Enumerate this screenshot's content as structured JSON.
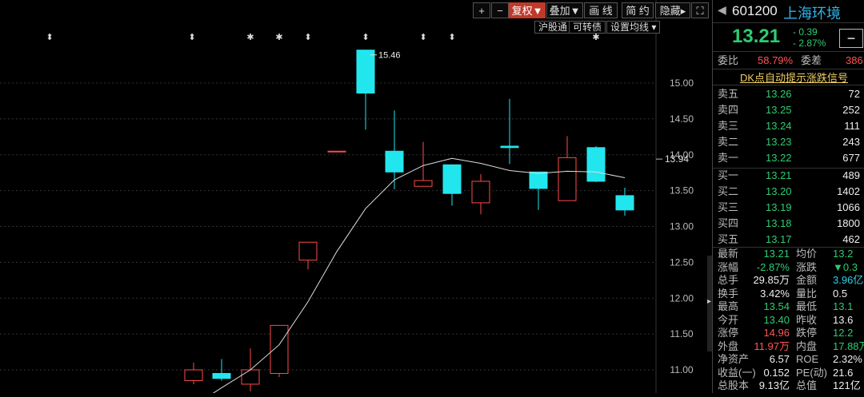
{
  "toolbar": {
    "plus": "+",
    "minus": "−",
    "fuquan": "复权▼",
    "diejia": "叠加▼",
    "huaxian": "画 线",
    "jianyue": "简 约",
    "yincang": "隐藏▸",
    "expand_icon": "⛶",
    "hugutong": "沪股通",
    "kezhuanzhai": "可转债",
    "shezhi_junxian": "设置均线 ▾"
  },
  "chart": {
    "max_label": "15.46",
    "current_price_label": "13.94",
    "y_ticks": [
      "15.00",
      "14.50",
      "14.00",
      "13.50",
      "13.00",
      "12.50",
      "12.00",
      "11.50",
      "11.00"
    ],
    "markers": [
      "⬍",
      "⬍",
      "✱",
      "✱",
      "⬍",
      "⬍",
      "⬍",
      "⬍",
      "✱"
    ]
  },
  "chart_data": {
    "type": "candlestick",
    "ylim": [
      10.7,
      15.8
    ],
    "colors": {
      "up": "#ff4a4a",
      "down": "#22e6ee",
      "ma": "#dddddd"
    },
    "candles": [
      {
        "o": 10.85,
        "c": 11.0,
        "h": 11.1,
        "l": 10.8
      },
      {
        "o": 10.95,
        "c": 10.88,
        "h": 11.15,
        "l": 10.85
      },
      {
        "o": 10.8,
        "c": 11.0,
        "h": 11.3,
        "l": 10.7
      },
      {
        "o": 10.95,
        "c": 11.62,
        "h": 11.62,
        "l": 10.9
      },
      {
        "o": 12.53,
        "c": 12.78,
        "h": 12.78,
        "l": 12.4
      },
      {
        "o": 14.05,
        "c": 14.05,
        "h": 14.05,
        "l": 14.05
      },
      {
        "o": 15.46,
        "c": 14.86,
        "h": 15.46,
        "l": 14.35
      },
      {
        "o": 14.05,
        "c": 13.76,
        "h": 14.62,
        "l": 13.52
      },
      {
        "o": 13.56,
        "c": 13.64,
        "h": 14.18,
        "l": 13.56
      },
      {
        "o": 13.86,
        "c": 13.46,
        "h": 13.86,
        "l": 13.29
      },
      {
        "o": 13.33,
        "c": 13.63,
        "h": 13.73,
        "l": 13.17
      },
      {
        "o": 14.12,
        "c": 14.1,
        "h": 14.78,
        "l": 13.87
      },
      {
        "o": 13.76,
        "c": 13.53,
        "h": 13.76,
        "l": 13.23
      },
      {
        "o": 13.36,
        "c": 13.96,
        "h": 14.26,
        "l": 13.36
      },
      {
        "o": 14.1,
        "c": 13.63,
        "h": 14.12,
        "l": 13.62
      },
      {
        "o": 13.43,
        "c": 13.23,
        "h": 13.54,
        "l": 13.15
      }
    ],
    "ma": [
      10.5,
      10.75,
      11.0,
      11.35,
      11.95,
      12.65,
      13.25,
      13.65,
      13.85,
      13.95,
      13.88,
      13.78,
      13.74,
      13.77,
      13.76,
      13.68
    ]
  },
  "quote": {
    "code": "601200",
    "name": "上海环境",
    "price": "13.21",
    "change": "- 0.39",
    "change_pct": "- 2.87%",
    "button": "−",
    "weibi_label": "委比",
    "weibi_value": "58.79%",
    "weicha_label": "委差",
    "weicha_value": "386",
    "signal_link": "DK点自动提示涨跌信号"
  },
  "orderbook": {
    "asks": [
      {
        "label": "卖五",
        "price": "13.26",
        "vol": "72"
      },
      {
        "label": "卖四",
        "price": "13.25",
        "vol": "252"
      },
      {
        "label": "卖三",
        "price": "13.24",
        "vol": "111"
      },
      {
        "label": "卖二",
        "price": "13.23",
        "vol": "243"
      },
      {
        "label": "卖一",
        "price": "13.22",
        "vol": "677"
      }
    ],
    "bids": [
      {
        "label": "买一",
        "price": "13.21",
        "vol": "489"
      },
      {
        "label": "买二",
        "price": "13.20",
        "vol": "1402"
      },
      {
        "label": "买三",
        "price": "13.19",
        "vol": "1066"
      },
      {
        "label": "买四",
        "price": "13.18",
        "vol": "1800"
      },
      {
        "label": "买五",
        "price": "13.17",
        "vol": "462"
      }
    ]
  },
  "stats": [
    {
      "l1": "最新",
      "v1": "13.21",
      "c1": "g",
      "l2": "均价",
      "v2": "13.2",
      "c2": "g"
    },
    {
      "l1": "涨幅",
      "v1": "-2.87%",
      "c1": "g",
      "l2": "涨跌",
      "v2": "▼0.3",
      "c2": "g"
    },
    {
      "l1": "总手",
      "v1": "29.85万",
      "c1": "w",
      "l2": "金额",
      "v2": "3.96亿",
      "c2": "c"
    },
    {
      "l1": "换手",
      "v1": "3.42%",
      "c1": "w",
      "l2": "量比",
      "v2": "0.5",
      "c2": "w"
    },
    {
      "l1": "最高",
      "v1": "13.54",
      "c1": "g",
      "l2": "最低",
      "v2": "13.1",
      "c2": "g"
    },
    {
      "l1": "今开",
      "v1": "13.40",
      "c1": "g",
      "l2": "昨收",
      "v2": "13.6",
      "c2": "w"
    },
    {
      "l1": "涨停",
      "v1": "14.96",
      "c1": "r",
      "l2": "跌停",
      "v2": "12.2",
      "c2": "g"
    },
    {
      "l1": "外盘",
      "v1": "11.97万",
      "c1": "r",
      "l2": "内盘",
      "v2": "17.88万",
      "c2": "g"
    },
    {
      "l1": "净资产",
      "v1": "6.57",
      "c1": "w",
      "l2": "ROE",
      "v2": "2.32%",
      "c2": "w"
    },
    {
      "l1": "收益(一)",
      "v1": "0.152",
      "c1": "w",
      "l2": "PE(动)",
      "v2": "21.6",
      "c2": "w"
    },
    {
      "l1": "总股本",
      "v1": "9.13亿",
      "c1": "w",
      "l2": "总值",
      "v2": "121亿",
      "c2": "w"
    }
  ]
}
